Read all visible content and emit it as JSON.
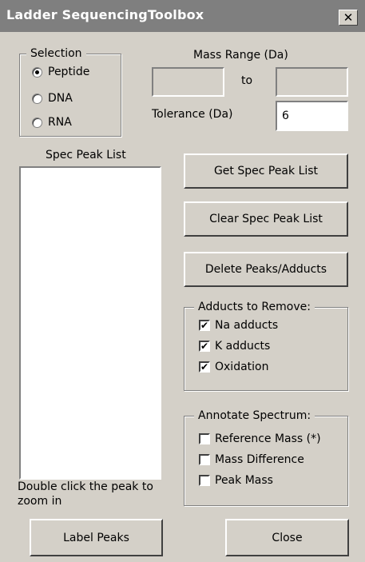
{
  "window": {
    "title": "Ladder SequencingToolbox",
    "close_glyph": "✕"
  },
  "selection": {
    "legend": "Selection",
    "options": [
      {
        "label": "Peptide",
        "selected": true
      },
      {
        "label": "DNA",
        "selected": false
      },
      {
        "label": "RNA",
        "selected": false
      }
    ]
  },
  "mass_range": {
    "label": "Mass Range (Da)",
    "to_label": "to",
    "from_value": "",
    "to_value": ""
  },
  "tolerance": {
    "label": "Tolerance (Da)",
    "value": "6"
  },
  "spec_peak_list": {
    "label": "Spec Peak List",
    "hint": "Double click the peak to zoom in",
    "items": []
  },
  "buttons": {
    "get_spec": "Get Spec Peak List",
    "clear_spec": "Clear Spec Peak List",
    "delete_peaks": "Delete Peaks/Adducts",
    "label_peaks": "Label Peaks",
    "close": "Close"
  },
  "adducts": {
    "legend": "Adducts to Remove:",
    "items": [
      {
        "label": "Na adducts",
        "checked": true
      },
      {
        "label": "K adducts",
        "checked": true
      },
      {
        "label": "Oxidation",
        "checked": true
      }
    ]
  },
  "annotate": {
    "legend": "Annotate Spectrum:",
    "items": [
      {
        "label": "Reference Mass (*)",
        "checked": false
      },
      {
        "label": "Mass Difference",
        "checked": false
      },
      {
        "label": "Peak Mass",
        "checked": false
      }
    ]
  }
}
